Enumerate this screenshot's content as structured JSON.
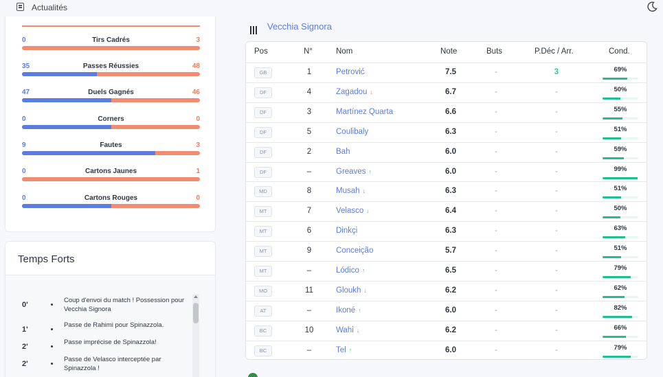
{
  "topbar": {
    "news_label": "Actualités",
    "news_icon": "newspaper-icon",
    "theme_icon": "moon-icon"
  },
  "stats": [
    {
      "name": "Tirs Cadrés",
      "home": "0",
      "away": "3",
      "home_share": 0.0
    },
    {
      "name": "Passes Réussies",
      "home": "35",
      "away": "48",
      "home_share": 0.42
    },
    {
      "name": "Duels Gagnés",
      "home": "47",
      "away": "46",
      "home_share": 0.5
    },
    {
      "name": "Corners",
      "home": "0",
      "away": "0",
      "home_share": 0.5
    },
    {
      "name": "Fautes",
      "home": "9",
      "away": "3",
      "home_share": 0.75
    },
    {
      "name": "Cartons Jaunes",
      "home": "0",
      "away": "1",
      "home_share": 0.0
    },
    {
      "name": "Cartons Rouges",
      "home": "0",
      "away": "0",
      "home_share": 0.5
    }
  ],
  "highlights": {
    "title": "Temps Forts",
    "events": [
      {
        "minute": "0'",
        "text": "Coup d'envoi du match ! Possession pour Vecchia Signora"
      },
      {
        "minute": "1'",
        "text": "Passe de Rahimi pour Spinazzola."
      },
      {
        "minute": "2'",
        "text": "Passe imprécise de Spinazzola!"
      },
      {
        "minute": "2'",
        "text": "Passe de Velasco interceptée par Spinazzola !"
      }
    ]
  },
  "team": {
    "name": "Vecchia Signora"
  },
  "table": {
    "headers": {
      "pos": "Pos",
      "num": "N°",
      "nom": "Nom",
      "note": "Note",
      "buts": "Buts",
      "pdec": "P.Déc / Arr.",
      "cond": "Cond."
    },
    "rows": [
      {
        "pos": "GB",
        "num": "1",
        "name": "Petrović",
        "arrow": "",
        "note": "7.5",
        "buts": "-",
        "pdec": "3",
        "cond": "69%"
      },
      {
        "pos": "DF",
        "num": "4",
        "name": "Zagadou",
        "arrow": "down",
        "note": "6.7",
        "buts": "-",
        "pdec": "-",
        "cond": "50%"
      },
      {
        "pos": "DF",
        "num": "3",
        "name": "Martínez Quarta",
        "arrow": "",
        "note": "6.6",
        "buts": "-",
        "pdec": "-",
        "cond": "55%"
      },
      {
        "pos": "DF",
        "num": "5",
        "name": "Coulibaly",
        "arrow": "",
        "note": "6.3",
        "buts": "-",
        "pdec": "-",
        "cond": "51%"
      },
      {
        "pos": "DF",
        "num": "2",
        "name": "Bah",
        "arrow": "",
        "note": "6.0",
        "buts": "-",
        "pdec": "-",
        "cond": "59%"
      },
      {
        "pos": "DF",
        "num": "–",
        "name": "Greaves",
        "arrow": "up",
        "note": "6.0",
        "buts": "-",
        "pdec": "-",
        "cond": "99%"
      },
      {
        "pos": "MD",
        "num": "8",
        "name": "Musah",
        "arrow": "down",
        "note": "6.3",
        "buts": "-",
        "pdec": "-",
        "cond": "51%"
      },
      {
        "pos": "MT",
        "num": "7",
        "name": "Velasco",
        "arrow": "down",
        "note": "6.4",
        "buts": "-",
        "pdec": "-",
        "cond": "50%"
      },
      {
        "pos": "MT",
        "num": "6",
        "name": "Dinkçi",
        "arrow": "",
        "note": "6.3",
        "buts": "-",
        "pdec": "-",
        "cond": "63%"
      },
      {
        "pos": "MT",
        "num": "9",
        "name": "Conceição",
        "arrow": "",
        "note": "5.7",
        "buts": "-",
        "pdec": "-",
        "cond": "51%"
      },
      {
        "pos": "MT",
        "num": "–",
        "name": "Lódico",
        "arrow": "up",
        "note": "6.5",
        "buts": "-",
        "pdec": "-",
        "cond": "79%"
      },
      {
        "pos": "MO",
        "num": "11",
        "name": "Gloukh",
        "arrow": "down",
        "note": "6.2",
        "buts": "-",
        "pdec": "-",
        "cond": "62%"
      },
      {
        "pos": "AT",
        "num": "–",
        "name": "Ikoné",
        "arrow": "up",
        "note": "6.0",
        "buts": "-",
        "pdec": "-",
        "cond": "82%"
      },
      {
        "pos": "BC",
        "num": "10",
        "name": "Wahi",
        "arrow": "down",
        "note": "6.2",
        "buts": "-",
        "pdec": "-",
        "cond": "66%"
      },
      {
        "pos": "BC",
        "num": "–",
        "name": "Tel",
        "arrow": "up",
        "note": "6.0",
        "buts": "-",
        "pdec": "-",
        "cond": "79%"
      }
    ]
  },
  "colors": {
    "home": "#5b7de0",
    "away": "#ef7d5a",
    "cond": "#1fbf92"
  }
}
